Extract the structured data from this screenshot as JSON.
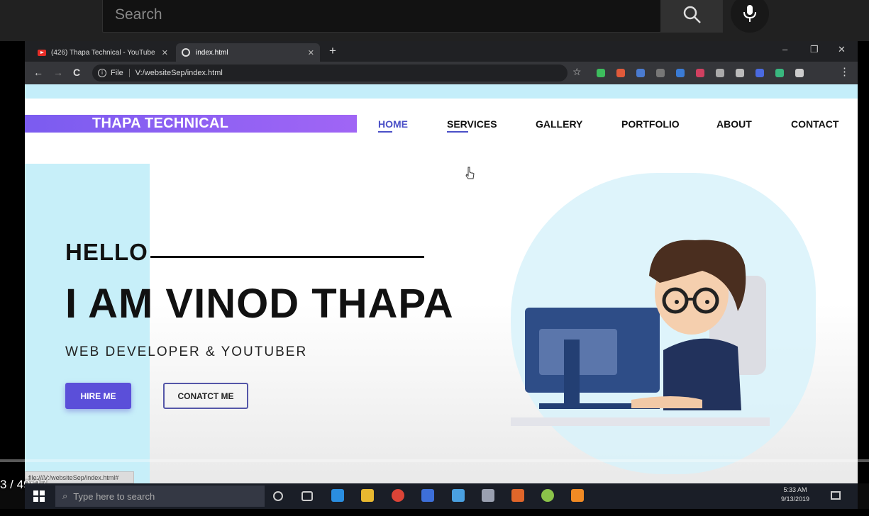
{
  "youtube": {
    "search_placeholder": "Search",
    "timestamp": "3 / 49:37"
  },
  "browser": {
    "tabs": [
      {
        "label": "(426) Thapa Technical - YouTube",
        "close": "✕"
      },
      {
        "label": "index.html",
        "close": "✕"
      }
    ],
    "new_tab": "+",
    "window_controls": {
      "minimize": "–",
      "restore": "❐",
      "close": "✕"
    },
    "nav": {
      "back": "←",
      "forward": "→",
      "reload": "C"
    },
    "address": {
      "scheme_label": "File",
      "url": "V:/websiteSep/index.html"
    },
    "bookmark_star": "☆",
    "menu": "⋮",
    "status_url": "file:///V:/websiteSep/index.html#",
    "extension_colors": [
      "#3dbd5d",
      "#e05a3a",
      "#4a7bd0",
      "#777777",
      "#3a7bd5",
      "#d04060",
      "#aaaaaa",
      "#bbbbbb",
      "#4a6ae0",
      "#39b87f",
      "#cccccc"
    ]
  },
  "site": {
    "logo": "THAPA TECHNICAL",
    "menu": [
      "HOME",
      "SERVICES",
      "GALLERY",
      "PORTFOLIO",
      "ABOUT",
      "CONTACT"
    ],
    "active_menu": "HOME",
    "greeting": "HELLO",
    "headline": "I AM VINOD THAPA",
    "subline": "WEB DEVELOPER & YOUTUBER",
    "primary_button": "HIRE ME",
    "secondary_button": "CONATCT ME",
    "colors": {
      "accent": "#5b4fd9",
      "logo_gradient_start": "#7b5cf0",
      "panel": "#c7eff9"
    }
  },
  "taskbar": {
    "search_placeholder": "Type here to search",
    "time": "5:33 AM",
    "date": "9/13/2019"
  }
}
